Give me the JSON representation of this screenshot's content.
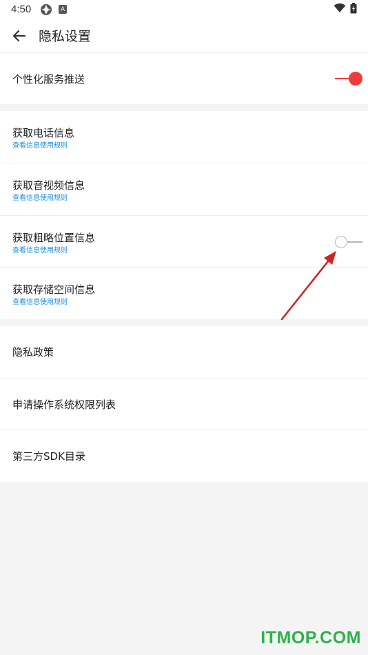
{
  "status_bar": {
    "time": "4:50",
    "b_label": "A"
  },
  "header": {
    "title": "隐私设置"
  },
  "section_personalization": {
    "label": "个性化服务推送",
    "enabled": true
  },
  "section_permissions": {
    "items": [
      {
        "title": "获取电话信息",
        "link": "查看信息使用规则"
      },
      {
        "title": "获取音视频信息",
        "link": "查看信息使用规则"
      },
      {
        "title": "获取粗略位置信息",
        "link": "查看信息使用规则",
        "enabled": false
      },
      {
        "title": "获取存储空间信息",
        "link": "查看信息使用规则"
      }
    ]
  },
  "section_links": {
    "items": [
      {
        "title": "隐私政策"
      },
      {
        "title": "申请操作系统权限列表"
      },
      {
        "title": "第三方SDK目录"
      }
    ]
  },
  "watermark": "ITMOP.COM",
  "colors": {
    "accent_red": "#ee3b3b",
    "link_blue": "#1f8fe0",
    "watermark_green": "#2bb34a"
  }
}
